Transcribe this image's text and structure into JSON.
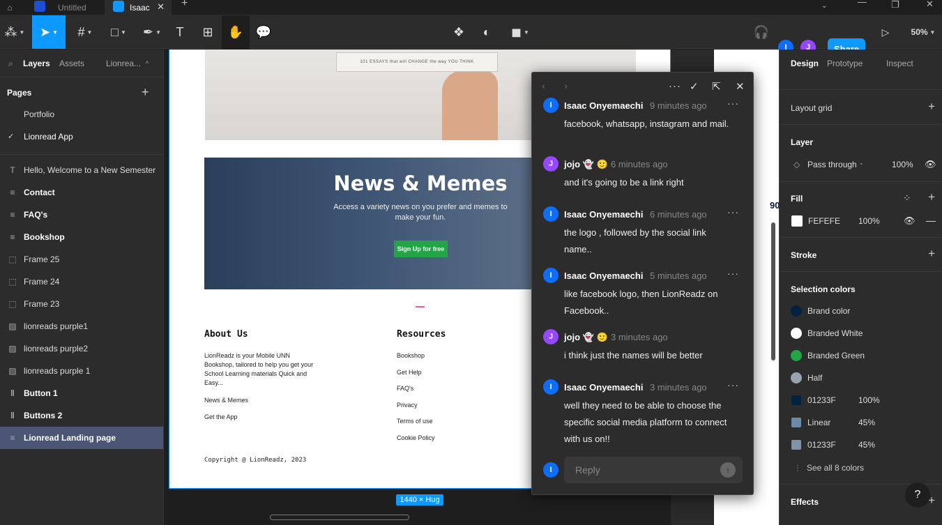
{
  "tabs": [
    {
      "label": "Untitled",
      "active": false
    },
    {
      "label": "Isaac",
      "active": true
    }
  ],
  "toolbar": {
    "users": [
      "I",
      "J"
    ],
    "share_label": "Share",
    "zoom": "50%"
  },
  "left_panel": {
    "tabs": [
      "Layers",
      "Assets",
      "Lionrea..."
    ],
    "pages_title": "Pages",
    "pages": [
      "Portfolio",
      "Lionread App"
    ],
    "layers": [
      {
        "label": "Hello, Welcome to a New Semester",
        "icon": "T",
        "bold": false
      },
      {
        "label": "Contact",
        "icon": "≡",
        "bold": true
      },
      {
        "label": "FAQ's",
        "icon": "≡",
        "bold": true
      },
      {
        "label": "Bookshop",
        "icon": "≡",
        "bold": true
      },
      {
        "label": "Frame 25",
        "icon": "⬚",
        "bold": false
      },
      {
        "label": "Frame 24",
        "icon": "⬚",
        "bold": false
      },
      {
        "label": "Frame 23",
        "icon": "⬚",
        "bold": false
      },
      {
        "label": "lionreads purple1",
        "icon": "▨",
        "bold": false
      },
      {
        "label": "lionreads purple2",
        "icon": "▨",
        "bold": false
      },
      {
        "label": "lionreads purple 1",
        "icon": "▨",
        "bold": false
      },
      {
        "label": "Button 1",
        "icon": "‖",
        "bold": true
      },
      {
        "label": "Buttons 2",
        "icon": "‖",
        "bold": true
      },
      {
        "label": "Lionread Landing page",
        "icon": "≡",
        "bold": true
      }
    ]
  },
  "canvas": {
    "book_text": "101 ESSAYS that will CHANGE the way YOU THINK",
    "news_title": "News & Memes",
    "news_sub": "Access a variety news on you prefer and memes to make your fun.",
    "signup_label": "Sign Up for free",
    "about_title": "About Us",
    "about_text": "LionReadz is your Mobile UNN Bookshop, tailored to help you get your School Learning materials Quick and Easy...",
    "about_links": [
      "News & Memes",
      "Get the App"
    ],
    "resources_title": "Resources",
    "resources_links": [
      "Bookshop",
      "Get Help",
      "FAQ's",
      "Privacy",
      "Terms of use",
      "Cookie Policy"
    ],
    "copyright": "Copyright @ LionReadz, 2023",
    "size_badge": "1440 × Hug",
    "side_number": "90"
  },
  "comments": {
    "items": [
      {
        "avatar": "I",
        "color": "#0d6efd",
        "name": "Isaac Onyemaechi",
        "time": "9 minutes ago",
        "text": "facebook, whatsapp, instagram and mail."
      },
      {
        "avatar": "J",
        "color": "#9747ff",
        "name": "jojo 👻 🙂",
        "time": "6 minutes ago",
        "text": "and it's going to be a link right"
      },
      {
        "avatar": "I",
        "color": "#0d6efd",
        "name": "Isaac Onyemaechi",
        "time": "6 minutes ago",
        "text": "the logo , followed by the social link name.."
      },
      {
        "avatar": "I",
        "color": "#0d6efd",
        "name": "Isaac Onyemaechi",
        "time": "5 minutes ago",
        "text": "like facebook logo, then LionReadz on Facebook.."
      },
      {
        "avatar": "J",
        "color": "#9747ff",
        "name": "jojo 👻 🙂",
        "time": "3 minutes ago",
        "text": "i think just the names will be better"
      },
      {
        "avatar": "I",
        "color": "#0d6efd",
        "name": "Isaac Onyemaechi",
        "time": "3 minutes ago",
        "text": "well they need to be able to choose the specific social media platform to connect with us on!!"
      }
    ],
    "reply_placeholder": "Reply",
    "reply_avatar": "I"
  },
  "right_panel": {
    "tabs": [
      "Design",
      "Prototype",
      "Inspect"
    ],
    "layout_grid": "Layout grid",
    "layer_title": "Layer",
    "blend_mode": "Pass through",
    "layer_opacity": "100%",
    "fill_title": "Fill",
    "fill_hex": "FEFEFE",
    "fill_opacity": "100%",
    "stroke_title": "Stroke",
    "selection_title": "Selection colors",
    "selection_colors": [
      {
        "label": "Brand color",
        "opacity": "",
        "color": "#01233f",
        "shape": "circle"
      },
      {
        "label": "Branded White",
        "opacity": "",
        "color": "#ffffff",
        "shape": "circle"
      },
      {
        "label": "Branded Green",
        "opacity": "",
        "color": "#22a447",
        "shape": "circle"
      },
      {
        "label": "Half",
        "opacity": "",
        "color": "#9aa3ad",
        "shape": "circle"
      },
      {
        "label": "01233F",
        "opacity": "100%",
        "color": "#01233f",
        "shape": "square"
      },
      {
        "label": "Linear",
        "opacity": "45%",
        "color": "#6b8aa6",
        "shape": "square"
      },
      {
        "label": "01233F",
        "opacity": "45%",
        "color": "#8094a8",
        "shape": "square"
      }
    ],
    "see_all": "See all 8 colors",
    "effects_title": "Effects"
  }
}
